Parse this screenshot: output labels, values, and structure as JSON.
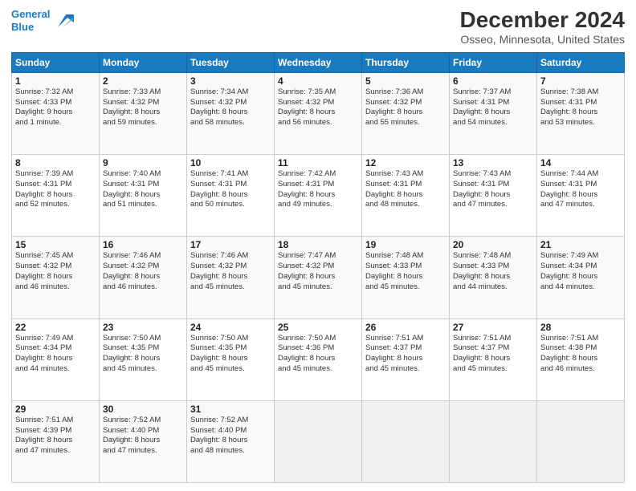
{
  "logo": {
    "line1": "General",
    "line2": "Blue"
  },
  "title": "December 2024",
  "subtitle": "Osseo, Minnesota, United States",
  "days_header": [
    "Sunday",
    "Monday",
    "Tuesday",
    "Wednesday",
    "Thursday",
    "Friday",
    "Saturday"
  ],
  "weeks": [
    [
      {
        "day": "1",
        "text": "Sunrise: 7:32 AM\nSunset: 4:33 PM\nDaylight: 9 hours\nand 1 minute."
      },
      {
        "day": "2",
        "text": "Sunrise: 7:33 AM\nSunset: 4:32 PM\nDaylight: 8 hours\nand 59 minutes."
      },
      {
        "day": "3",
        "text": "Sunrise: 7:34 AM\nSunset: 4:32 PM\nDaylight: 8 hours\nand 58 minutes."
      },
      {
        "day": "4",
        "text": "Sunrise: 7:35 AM\nSunset: 4:32 PM\nDaylight: 8 hours\nand 56 minutes."
      },
      {
        "day": "5",
        "text": "Sunrise: 7:36 AM\nSunset: 4:32 PM\nDaylight: 8 hours\nand 55 minutes."
      },
      {
        "day": "6",
        "text": "Sunrise: 7:37 AM\nSunset: 4:31 PM\nDaylight: 8 hours\nand 54 minutes."
      },
      {
        "day": "7",
        "text": "Sunrise: 7:38 AM\nSunset: 4:31 PM\nDaylight: 8 hours\nand 53 minutes."
      }
    ],
    [
      {
        "day": "8",
        "text": "Sunrise: 7:39 AM\nSunset: 4:31 PM\nDaylight: 8 hours\nand 52 minutes."
      },
      {
        "day": "9",
        "text": "Sunrise: 7:40 AM\nSunset: 4:31 PM\nDaylight: 8 hours\nand 51 minutes."
      },
      {
        "day": "10",
        "text": "Sunrise: 7:41 AM\nSunset: 4:31 PM\nDaylight: 8 hours\nand 50 minutes."
      },
      {
        "day": "11",
        "text": "Sunrise: 7:42 AM\nSunset: 4:31 PM\nDaylight: 8 hours\nand 49 minutes."
      },
      {
        "day": "12",
        "text": "Sunrise: 7:43 AM\nSunset: 4:31 PM\nDaylight: 8 hours\nand 48 minutes."
      },
      {
        "day": "13",
        "text": "Sunrise: 7:43 AM\nSunset: 4:31 PM\nDaylight: 8 hours\nand 47 minutes."
      },
      {
        "day": "14",
        "text": "Sunrise: 7:44 AM\nSunset: 4:31 PM\nDaylight: 8 hours\nand 47 minutes."
      }
    ],
    [
      {
        "day": "15",
        "text": "Sunrise: 7:45 AM\nSunset: 4:32 PM\nDaylight: 8 hours\nand 46 minutes."
      },
      {
        "day": "16",
        "text": "Sunrise: 7:46 AM\nSunset: 4:32 PM\nDaylight: 8 hours\nand 46 minutes."
      },
      {
        "day": "17",
        "text": "Sunrise: 7:46 AM\nSunset: 4:32 PM\nDaylight: 8 hours\nand 45 minutes."
      },
      {
        "day": "18",
        "text": "Sunrise: 7:47 AM\nSunset: 4:32 PM\nDaylight: 8 hours\nand 45 minutes."
      },
      {
        "day": "19",
        "text": "Sunrise: 7:48 AM\nSunset: 4:33 PM\nDaylight: 8 hours\nand 45 minutes."
      },
      {
        "day": "20",
        "text": "Sunrise: 7:48 AM\nSunset: 4:33 PM\nDaylight: 8 hours\nand 44 minutes."
      },
      {
        "day": "21",
        "text": "Sunrise: 7:49 AM\nSunset: 4:34 PM\nDaylight: 8 hours\nand 44 minutes."
      }
    ],
    [
      {
        "day": "22",
        "text": "Sunrise: 7:49 AM\nSunset: 4:34 PM\nDaylight: 8 hours\nand 44 minutes."
      },
      {
        "day": "23",
        "text": "Sunrise: 7:50 AM\nSunset: 4:35 PM\nDaylight: 8 hours\nand 45 minutes."
      },
      {
        "day": "24",
        "text": "Sunrise: 7:50 AM\nSunset: 4:35 PM\nDaylight: 8 hours\nand 45 minutes."
      },
      {
        "day": "25",
        "text": "Sunrise: 7:50 AM\nSunset: 4:36 PM\nDaylight: 8 hours\nand 45 minutes."
      },
      {
        "day": "26",
        "text": "Sunrise: 7:51 AM\nSunset: 4:37 PM\nDaylight: 8 hours\nand 45 minutes."
      },
      {
        "day": "27",
        "text": "Sunrise: 7:51 AM\nSunset: 4:37 PM\nDaylight: 8 hours\nand 45 minutes."
      },
      {
        "day": "28",
        "text": "Sunrise: 7:51 AM\nSunset: 4:38 PM\nDaylight: 8 hours\nand 46 minutes."
      }
    ],
    [
      {
        "day": "29",
        "text": "Sunrise: 7:51 AM\nSunset: 4:39 PM\nDaylight: 8 hours\nand 47 minutes."
      },
      {
        "day": "30",
        "text": "Sunrise: 7:52 AM\nSunset: 4:40 PM\nDaylight: 8 hours\nand 47 minutes."
      },
      {
        "day": "31",
        "text": "Sunrise: 7:52 AM\nSunset: 4:40 PM\nDaylight: 8 hours\nand 48 minutes."
      },
      {
        "day": "",
        "text": ""
      },
      {
        "day": "",
        "text": ""
      },
      {
        "day": "",
        "text": ""
      },
      {
        "day": "",
        "text": ""
      }
    ]
  ]
}
